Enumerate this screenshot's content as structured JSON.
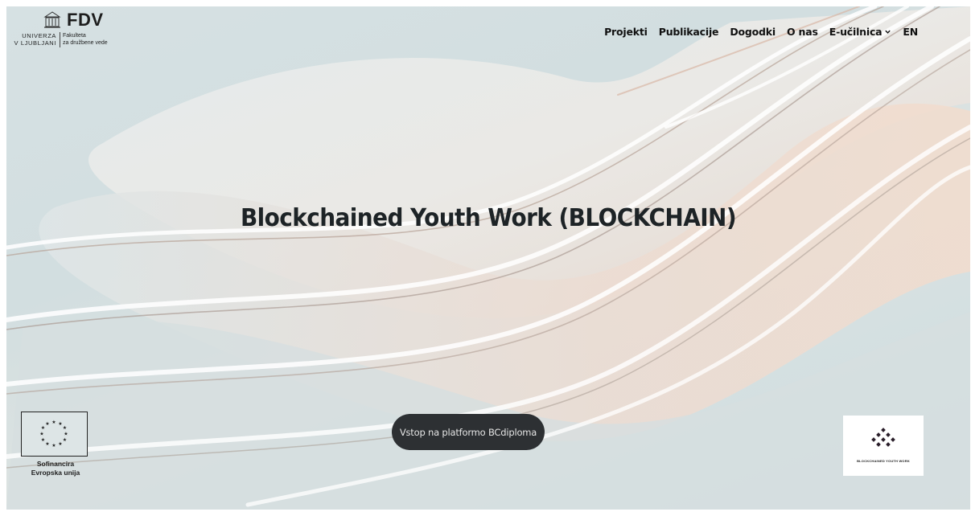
{
  "header": {
    "logo": {
      "mark": "FDV",
      "university_lines": [
        "UNIVERZA",
        "V LJUBLJANI"
      ],
      "faculty_lines": [
        "Fakulteta",
        "za družbene vede"
      ]
    },
    "nav": {
      "items": [
        "Projekti",
        "Publikacije",
        "Dogodki",
        "O nas"
      ],
      "dropdown_label": "E-učilnica",
      "lang": "EN"
    }
  },
  "hero": {
    "title": "Blockchained Youth Work (BLOCKCHAIN)",
    "cta_label": "Vstop na platformo BCdiploma"
  },
  "eu": {
    "text_lines": [
      "Sofinancira",
      "Evropska unija"
    ]
  },
  "badge": {
    "text": "BLOCKCHAINED YOUTH WORK"
  },
  "colors": {
    "cta_bg": "#2d3033",
    "text_dark": "#1d2326"
  }
}
